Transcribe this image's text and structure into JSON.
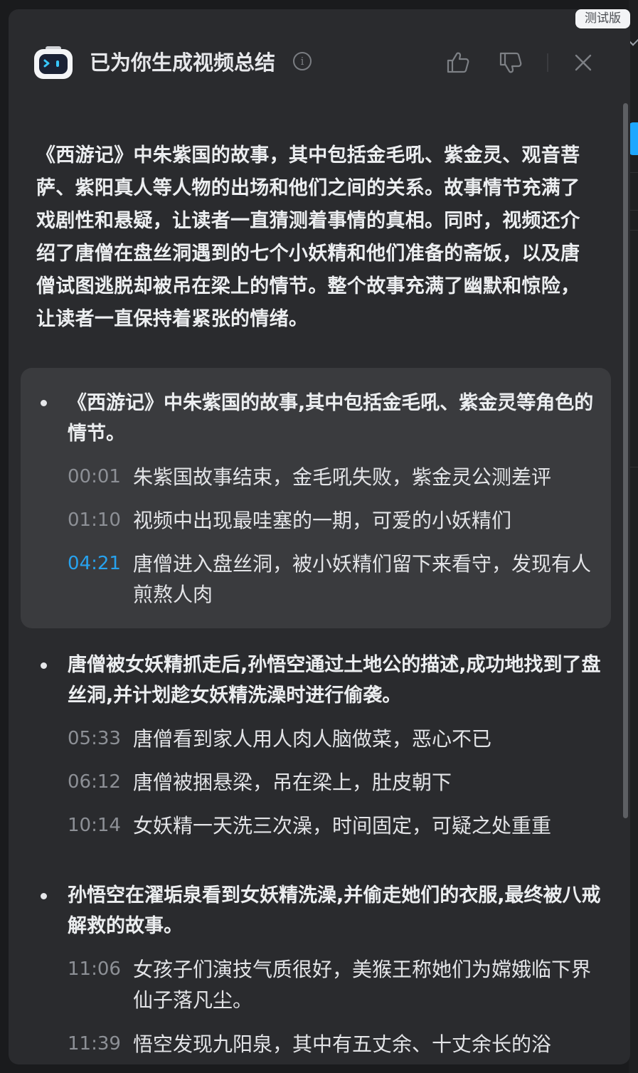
{
  "badge": "测试版",
  "header": {
    "title": "已为你生成视频总结"
  },
  "summary": "《西游记》中朱紫国的故事，其中包括金毛吼、紫金灵、观音菩萨、紫阳真人等人物的出场和他们之间的关系。故事情节充满了戏剧性和悬疑，让读者一直猜测着事情的真相。同时，视频还介绍了唐僧在盘丝洞遇到的七个小妖精和他们准备的斋饭，以及唐僧试图逃脱却被吊在梁上的情节。整个故事充满了幽默和惊险，让读者一直保持着紧张的情绪。",
  "sections": [
    {
      "title": "《西游记》中朱紫国的故事,其中包括金毛吼、紫金灵等角色的情节。",
      "items": [
        {
          "time": "00:01",
          "text": "朱紫国故事结束，金毛吼失败，紫金灵公测差评",
          "active": false
        },
        {
          "time": "01:10",
          "text": "视频中出现最哇塞的一期，可爱的小妖精们",
          "active": false
        },
        {
          "time": "04:21",
          "text": "唐僧进入盘丝洞，被小妖精们留下来看守，发现有人煎熬人肉",
          "active": true
        }
      ]
    },
    {
      "title": "唐僧被女妖精抓走后,孙悟空通过土地公的描述,成功地找到了盘丝洞,并计划趁女妖精洗澡时进行偷袭。",
      "items": [
        {
          "time": "05:33",
          "text": "唐僧看到家人用人肉人脑做菜，恶心不已",
          "active": false
        },
        {
          "time": "06:12",
          "text": "唐僧被捆悬梁，吊在梁上，肚皮朝下",
          "active": false
        },
        {
          "time": "10:14",
          "text": "女妖精一天洗三次澡，时间固定，可疑之处重重",
          "active": false
        }
      ]
    },
    {
      "title": "孙悟空在濯垢泉看到女妖精洗澡,并偷走她们的衣服,最终被八戒解救的故事。",
      "items": [
        {
          "time": "11:06",
          "text": "女孩子们演技气质很好，美猴王称她们为嫦娥临下界仙子落凡尘。",
          "active": false
        },
        {
          "time": "11:39",
          "text": "悟空发现九阳泉，其中有五丈余、十丈余长的浴",
          "active": false
        }
      ]
    }
  ],
  "colors": {
    "panel_bg": "#2a2b2e",
    "highlight_bg": "#3a3b3e",
    "accent_timestamp": "#27a2ee"
  },
  "icons": [
    "robot-icon",
    "info-icon",
    "thumbs-up-icon",
    "thumbs-down-icon",
    "close-icon",
    "chevron-down-icon"
  ]
}
